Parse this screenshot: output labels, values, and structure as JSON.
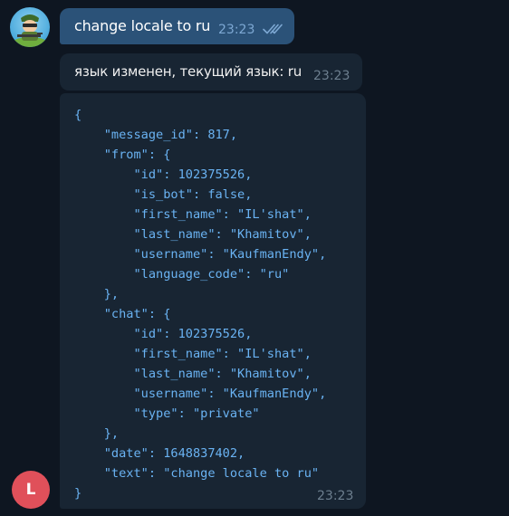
{
  "messages": {
    "outgoing": {
      "text": "change locale to ru",
      "time": "23:23",
      "status_icon": "double-check-icon"
    },
    "reply": {
      "text": "язык изменен, текущий язык: ru",
      "time": "23:23"
    },
    "json_reply": {
      "time": "23:23",
      "lines": [
        "{",
        "    \"message_id\": 817,",
        "    \"from\": {",
        "        \"id\": 102375526,",
        "        \"is_bot\": false,",
        "        \"first_name\": \"IL'shat\",",
        "        \"last_name\": \"Khamitov\",",
        "        \"username\": \"KaufmanEndy\",",
        "        \"language_code\": \"ru\"",
        "    },",
        "    \"chat\": {",
        "        \"id\": 102375526,",
        "        \"first_name\": \"IL'shat\",",
        "        \"last_name\": \"Khamitov\",",
        "        \"username\": \"KaufmanEndy\",",
        "        \"type\": \"private\"",
        "    },",
        "    \"date\": 1648837402,",
        "    \"text\": \"change locale to ru\"",
        "}"
      ]
    }
  },
  "bot_avatar": {
    "letter": "L",
    "color": "#e0505a"
  },
  "colors": {
    "background": "#0e1621",
    "outgoing_bubble": "#2b5278",
    "incoming_bubble": "#182533",
    "code_text": "#6ab3f3"
  }
}
